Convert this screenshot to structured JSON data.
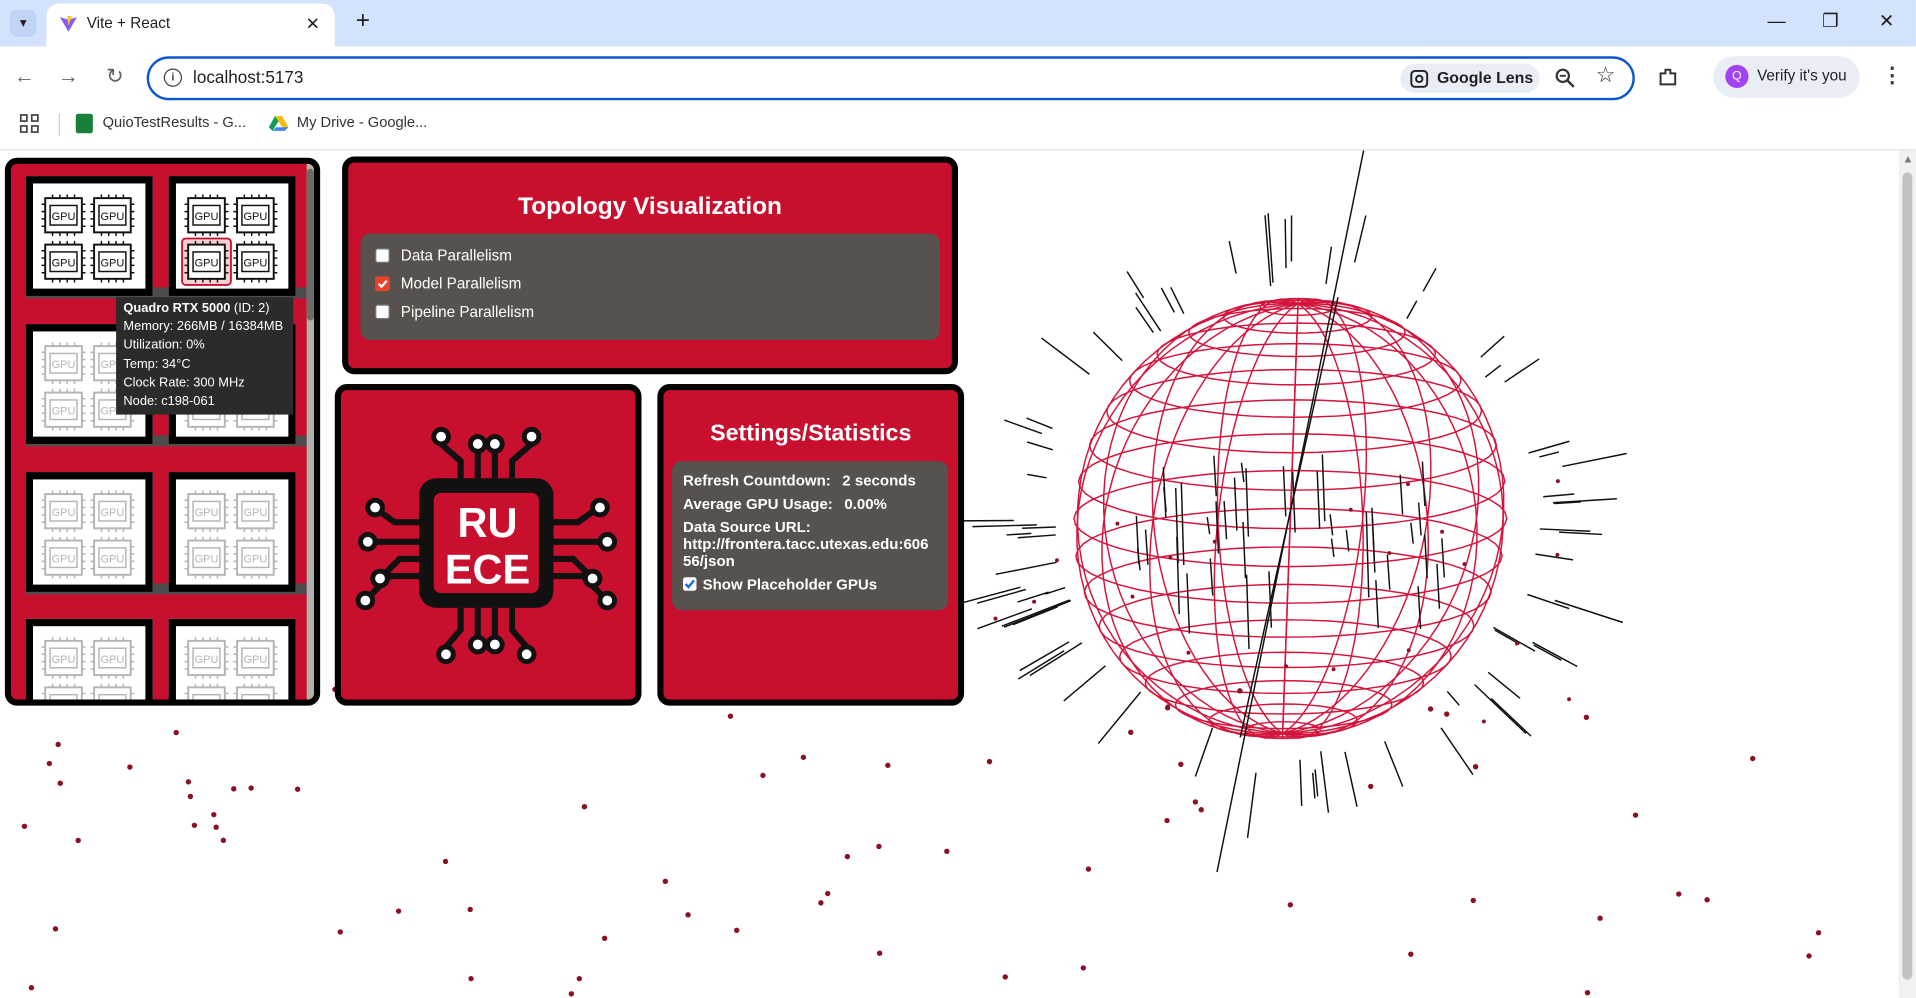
{
  "browser": {
    "tab_title": "Vite + React",
    "url": "localhost:5173",
    "lens_label": "Google Lens",
    "profile_label": "Verify it's you",
    "profile_initial": "Q",
    "bookmarks": [
      {
        "label": "QuioTestResults - G...",
        "icon": "sheets-icon"
      },
      {
        "label": "My Drive - Google...",
        "icon": "drive-icon"
      }
    ]
  },
  "gpu_grid": {
    "chip_label": "GPU",
    "tooltip": {
      "name": "Quadro RTX 5000",
      "id_text": " (ID: 2)",
      "lines": [
        "Memory: 266MB / 16384MB",
        "Utilization: 0%",
        "Temp: 34°C",
        "Clock Rate: 300 MHz",
        "Node: c198-061"
      ]
    }
  },
  "topology": {
    "title": "Topology Visualization",
    "options": [
      {
        "label": "Data Parallelism",
        "checked": false
      },
      {
        "label": "Model Parallelism",
        "checked": true
      },
      {
        "label": "Pipeline Parallelism",
        "checked": false
      }
    ]
  },
  "logo": {
    "line1": "RU",
    "line2": "ECE"
  },
  "settings": {
    "title": "Settings/Statistics",
    "refresh_label": "Refresh Countdown:",
    "refresh_value": "2 seconds",
    "avg_label": "Average GPU Usage:",
    "avg_value": "0.00%",
    "source_label": "Data Source URL:",
    "source_line1": "http://frontera.tacc.utexas.edu:606",
    "source_line2": "56/json",
    "placeholder_label": "Show Placeholder GPUs",
    "placeholder_checked": true
  },
  "colors": {
    "accent": "#c8102e",
    "panel_border": "#000000",
    "sphere": "#d4143c",
    "dots": "#8b1024"
  }
}
